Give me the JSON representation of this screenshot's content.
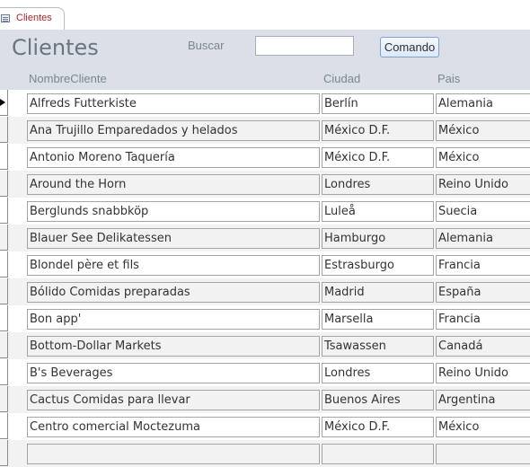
{
  "tab": {
    "label": "Clientes",
    "icon": "form-icon"
  },
  "header": {
    "title": "Clientes",
    "search_label": "Buscar",
    "search_value": "",
    "command_label": "Comando",
    "columns": [
      "NombreCliente",
      "Ciudad",
      "Pais"
    ]
  },
  "rows": [
    {
      "nombre": "Alfreds Futterkiste",
      "ciudad": "Berlín",
      "pais": "Alemania"
    },
    {
      "nombre": "Ana Trujillo Emparedados y helados",
      "ciudad": "México D.F.",
      "pais": "México"
    },
    {
      "nombre": "Antonio Moreno Taquería",
      "ciudad": "México D.F.",
      "pais": "México"
    },
    {
      "nombre": "Around the Horn",
      "ciudad": "Londres",
      "pais": "Reino Unido"
    },
    {
      "nombre": "Berglunds snabbköp",
      "ciudad": "Luleå",
      "pais": "Suecia"
    },
    {
      "nombre": "Blauer See Delikatessen",
      "ciudad": "Hamburgo",
      "pais": "Alemania"
    },
    {
      "nombre": "Blondel père et fils",
      "ciudad": "Estrasburgo",
      "pais": "Francia"
    },
    {
      "nombre": "Bólido Comidas preparadas",
      "ciudad": "Madrid",
      "pais": "España"
    },
    {
      "nombre": "Bon app'",
      "ciudad": "Marsella",
      "pais": "Francia"
    },
    {
      "nombre": "Bottom-Dollar Markets",
      "ciudad": "Tsawassen",
      "pais": "Canadá"
    },
    {
      "nombre": "B's Beverages",
      "ciudad": "Londres",
      "pais": "Reino Unido"
    },
    {
      "nombre": "Cactus Comidas para llevar",
      "ciudad": "Buenos Aires",
      "pais": "Argentina"
    },
    {
      "nombre": "Centro comercial Moctezuma",
      "ciudad": "México D.F.",
      "pais": "México"
    },
    {
      "nombre": "",
      "ciudad": "",
      "pais": ""
    }
  ],
  "colors": {
    "header_bg": "#dadfe8",
    "alt_row_bg": "#f2f2f2",
    "tab_text": "#a4262c"
  }
}
